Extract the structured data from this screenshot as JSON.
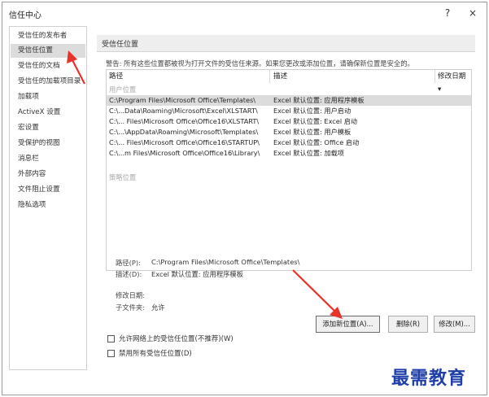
{
  "window": {
    "title": "信任中心",
    "help_label": "?",
    "close_label": "×"
  },
  "nav": {
    "items": [
      {
        "label": "受信任的发布者"
      },
      {
        "label": "受信任位置"
      },
      {
        "label": "受信任的文档"
      },
      {
        "label": "受信任的加载项目录"
      },
      {
        "label": "加载项"
      },
      {
        "label": "ActiveX 设置"
      },
      {
        "label": "宏设置"
      },
      {
        "label": "受保护的视图"
      },
      {
        "label": "消息栏"
      },
      {
        "label": "外部内容"
      },
      {
        "label": "文件阻止设置"
      },
      {
        "label": "隐私选项"
      }
    ],
    "selected_index": 1
  },
  "main": {
    "section_title": "受信任位置",
    "warning": "警告: 所有这些位置都被视为打开文件的受信任来源。如果您更改或添加位置，请确保新位置是安全的。",
    "columns": {
      "path": "路径",
      "description": "描述",
      "modified": "修改日期 ▾"
    },
    "user_group_label": "用户位置",
    "policy_group_label": "策略位置",
    "rows": [
      {
        "path": "C:\\Program Files\\Microsoft Office\\Templates\\",
        "desc": "Excel 默认位置: 应用程序模板",
        "selected": true
      },
      {
        "path": "C:\\...Data\\Roaming\\Microsoft\\Excel\\XLSTART\\",
        "desc": "Excel 默认位置: 用户启动"
      },
      {
        "path": "C:\\... Files\\Microsoft Office\\Office16\\XLSTART\\",
        "desc": "Excel 默认位置: Excel 启动"
      },
      {
        "path": "C:\\...\\AppData\\Roaming\\Microsoft\\Templates\\",
        "desc": "Excel 默认位置: 用户模板"
      },
      {
        "path": "C:\\... Files\\Microsoft Office\\Office16\\STARTUP\\",
        "desc": "Excel 默认位置: Office 启动"
      },
      {
        "path": "C:\\...m Files\\Microsoft Office\\Office16\\Library\\",
        "desc": "Excel 默认位置: 加载项"
      }
    ],
    "details": {
      "path_label": "路径(P):",
      "path_value": "C:\\Program Files\\Microsoft Office\\Templates\\",
      "desc_label": "描述(D):",
      "desc_value": "Excel 默认位置: 应用程序模板",
      "modified_label": "修改日期:",
      "modified_value": "",
      "subfolders_label": "子文件夹:",
      "subfolders_value": "允许"
    },
    "buttons": {
      "add": "添加新位置(A)...",
      "remove": "删除(R)",
      "modify": "修改(M)..."
    },
    "checkboxes": {
      "allow_network": {
        "label": "允许网络上的受信任位置(不推荐)(W)",
        "checked": false
      },
      "disable_all": {
        "label": "禁用所有受信任位置(D)",
        "checked": false
      }
    }
  },
  "watermark": "最需教育",
  "colors": {
    "annotation_arrow": "#e8332a",
    "watermark": "#1e3fa8",
    "selection": "#dcdcdc"
  }
}
